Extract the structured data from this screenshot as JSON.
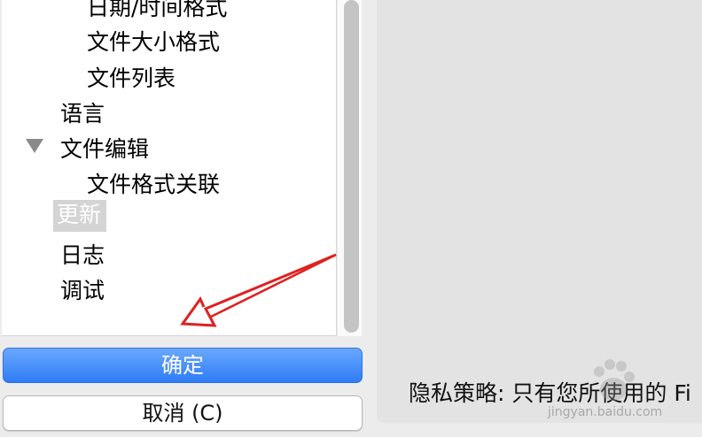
{
  "tree": {
    "items": [
      {
        "label": "日期/时间格式"
      },
      {
        "label": "文件大小格式"
      },
      {
        "label": "文件列表"
      },
      {
        "label": "语言"
      },
      {
        "label": "文件编辑"
      },
      {
        "label": "文件格式关联"
      },
      {
        "label": "更新"
      },
      {
        "label": "日志"
      },
      {
        "label": "调试"
      }
    ],
    "selected_item": "更新",
    "expanded_item_icon": "disclosure-triangle-down"
  },
  "buttons": {
    "ok_label": "确定",
    "cancel_label": "取消 (C)"
  },
  "content": {
    "privacy_text": "隐私策略: 只有您所使用的 Fi"
  },
  "annotation": {
    "arrow_color": "#e02020",
    "arrow_icon": "red-arrow-pointing-down-left"
  },
  "watermark": {
    "text": "jingyan.baidu.com",
    "icon": "baidu-paw-icon"
  },
  "colors": {
    "primary_button": "#2f7cf6",
    "selection_background": "#d4d4d4",
    "window_background": "#ececec"
  }
}
